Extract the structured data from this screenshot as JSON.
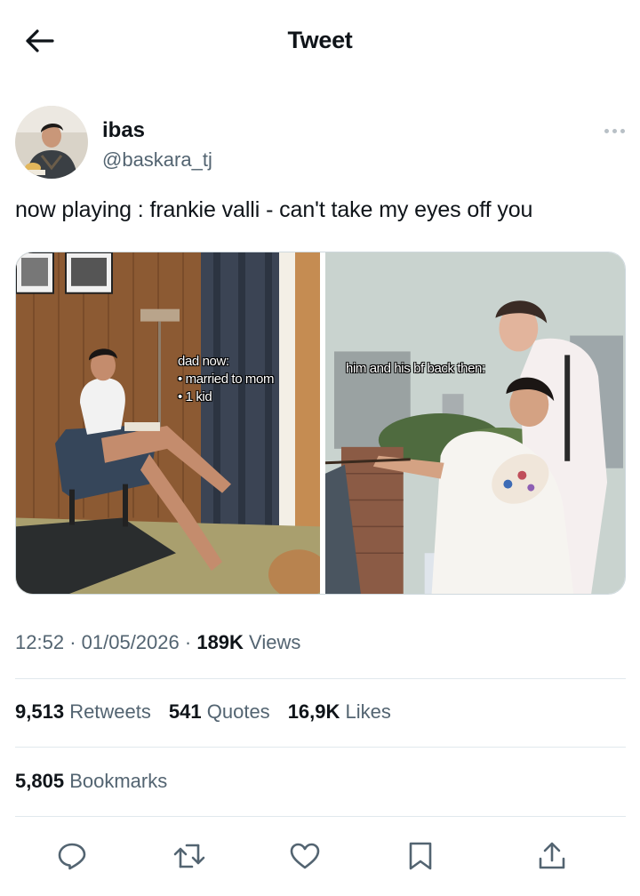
{
  "header": {
    "title": "Tweet",
    "back_icon": "arrow-left-icon"
  },
  "author": {
    "display_name": "ibas",
    "handle": "@baskara_tj",
    "more_icon": "more-horizontal-icon"
  },
  "tweet": {
    "text": "now playing : frankie valli - can't take my eyes off you",
    "media": {
      "left_caption": [
        "dad now:",
        "• married to mom",
        "• 1 kid"
      ],
      "right_caption": "him and his bf back then:"
    }
  },
  "meta": {
    "time": "12:52",
    "separator": "·",
    "date": "01/05/2026",
    "views_count": "189K",
    "views_label": "Views"
  },
  "stats": {
    "retweets_count": "9,513",
    "retweets_label": "Retweets",
    "quotes_count": "541",
    "quotes_label": "Quotes",
    "likes_count": "16,9K",
    "likes_label": "Likes",
    "bookmarks_count": "5,805",
    "bookmarks_label": "Bookmarks"
  },
  "actions": [
    "reply-icon",
    "retweet-icon",
    "like-icon",
    "bookmark-icon",
    "share-icon"
  ],
  "colors": {
    "text_primary": "#0f1419",
    "text_secondary": "#536471",
    "divider": "#e1e8ed"
  }
}
